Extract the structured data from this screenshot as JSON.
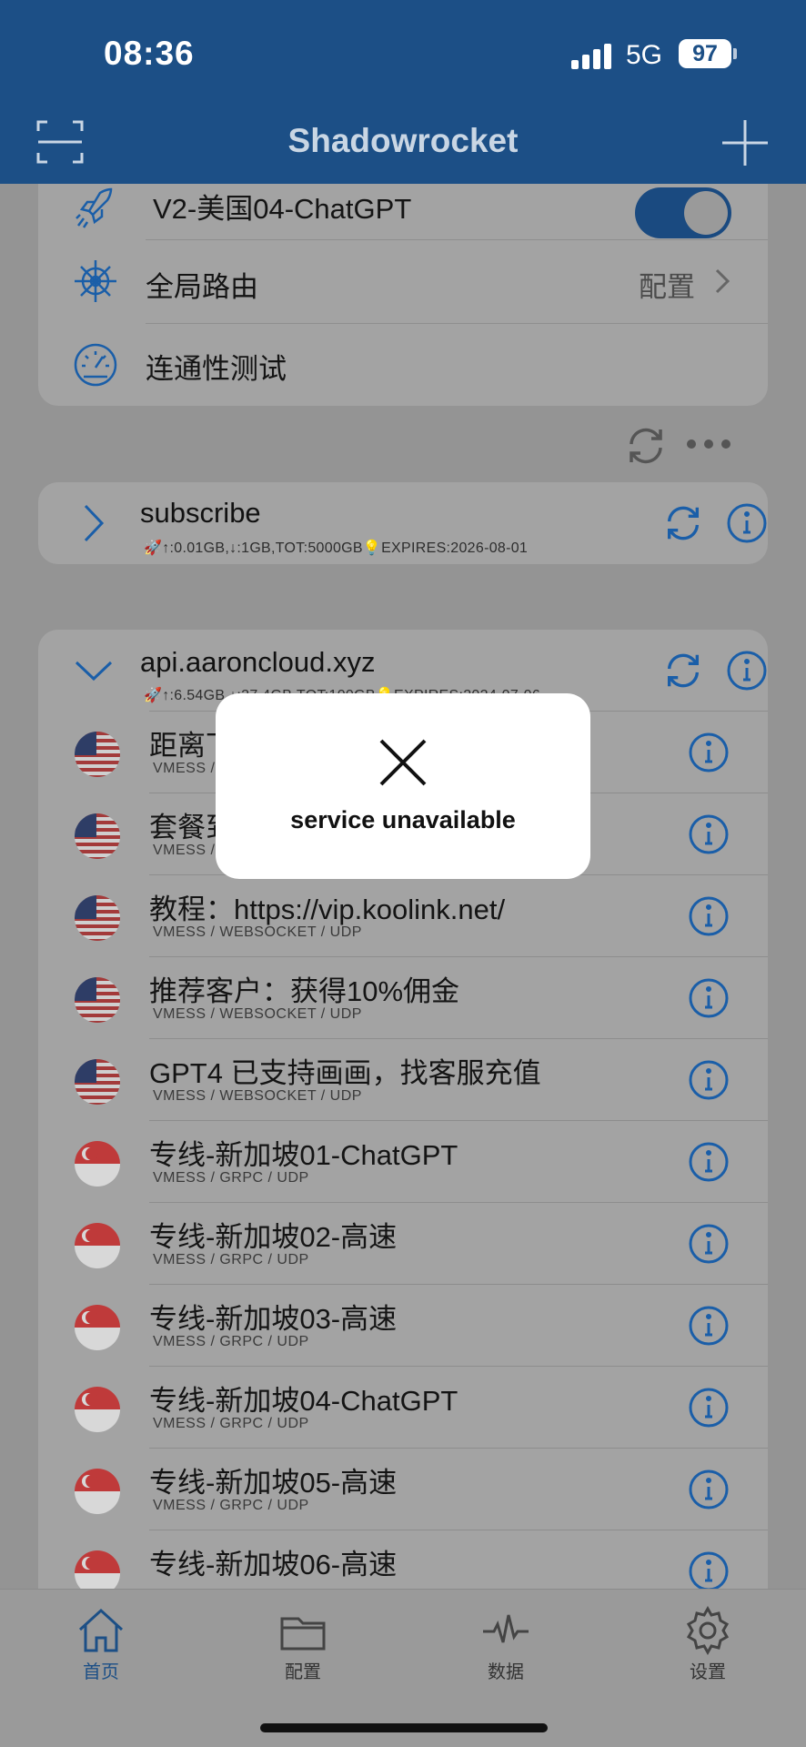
{
  "status_bar": {
    "time": "08:36",
    "network": "5G",
    "battery": "97"
  },
  "nav": {
    "title": "Shadowrocket"
  },
  "main_card": {
    "server_row": {
      "label": "V2-美国04-ChatGPT",
      "enabled": true
    },
    "routing_row": {
      "label": "全局路由",
      "value": "配置"
    },
    "test_row": {
      "label": "连通性测试"
    }
  },
  "groups": [
    {
      "title": "subscribe",
      "subtitle": "🚀↑:0.01GB,↓:1GB,TOT:5000GB💡EXPIRES:2026-08-01"
    },
    {
      "title": "api.aaroncloud.xyz",
      "subtitle": "🚀↑:6.54GB,↓:27.4GB,TOT:100GB💡EXPIRES:2024-07-06"
    }
  ],
  "servers": [
    {
      "name": "距离下次重置剩余：",
      "proto": "VMESS / WEBSOCKET / UDP",
      "flag": "us"
    },
    {
      "name": "套餐到期：2024-07-06",
      "proto": "VMESS / WEBSOCKET / UDP",
      "flag": "us"
    },
    {
      "name": "教程：https://vip.koolink.net/",
      "proto": "VMESS / WEBSOCKET / UDP",
      "flag": "us"
    },
    {
      "name": "推荐客户：获得10%佣金",
      "proto": "VMESS / WEBSOCKET / UDP",
      "flag": "us"
    },
    {
      "name": "GPT4 已支持画画，找客服充值",
      "proto": "VMESS / WEBSOCKET / UDP",
      "flag": "us"
    },
    {
      "name": " 专线-新加坡01-ChatGPT",
      "proto": "VMESS / GRPC / UDP",
      "flag": "sg"
    },
    {
      "name": " 专线-新加坡02-高速",
      "proto": "VMESS / GRPC / UDP",
      "flag": "sg"
    },
    {
      "name": " 专线-新加坡03-高速",
      "proto": "VMESS / GRPC / UDP",
      "flag": "sg"
    },
    {
      "name": " 专线-新加坡04-ChatGPT",
      "proto": "VMESS / GRPC / UDP",
      "flag": "sg"
    },
    {
      "name": " 专线-新加坡05-高速",
      "proto": "VMESS / GRPC / UDP",
      "flag": "sg"
    },
    {
      "name": " 专线-新加坡06-高速",
      "proto": "",
      "flag": "sg"
    }
  ],
  "tabs": [
    {
      "label": "首页",
      "icon": "home-icon",
      "active": true
    },
    {
      "label": "配置",
      "icon": "folder-icon",
      "active": false
    },
    {
      "label": "数据",
      "icon": "pulse-icon",
      "active": false
    },
    {
      "label": "设置",
      "icon": "gear-icon",
      "active": false
    }
  ],
  "modal": {
    "message": "service unavailable",
    "icon": "close-icon"
  },
  "colors": {
    "brand": "#1c4f86",
    "accent": "#1a5ea8",
    "overlay_bg": "#949494",
    "modal_bg": "#ffffff"
  }
}
